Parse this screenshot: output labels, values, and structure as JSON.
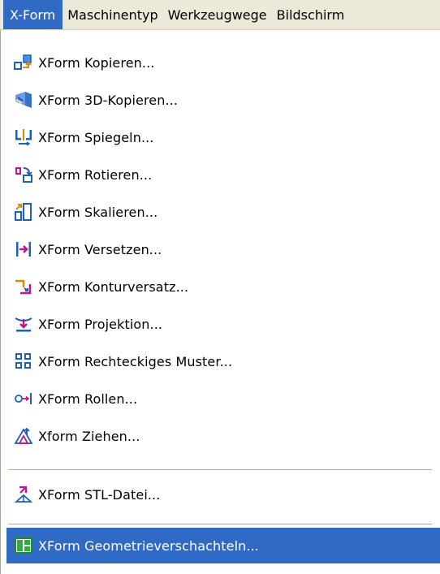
{
  "menubar": {
    "items": [
      "X-Form",
      "Maschinentyp",
      "Werkzeugwege",
      "Bildschirm"
    ],
    "active_index": 0
  },
  "menu": {
    "items": [
      {
        "label": "XForm Kopieren...",
        "icon": "copy-icon"
      },
      {
        "label": "XForm 3D-Kopieren...",
        "icon": "3d-copy-icon"
      },
      {
        "label": "XForm Spiegeln...",
        "icon": "mirror-icon"
      },
      {
        "label": "XForm Rotieren...",
        "icon": "rotate-icon"
      },
      {
        "label": "XForm Skalieren...",
        "icon": "scale-icon"
      },
      {
        "label": "XForm Versetzen...",
        "icon": "translate-icon"
      },
      {
        "label": "XForm Konturversatz...",
        "icon": "contour-offset-icon"
      },
      {
        "label": "XForm Projektion...",
        "icon": "projection-icon"
      },
      {
        "label": "XForm Rechteckiges Muster...",
        "icon": "rectangular-pattern-icon"
      },
      {
        "label": "XForm Rollen...",
        "icon": "roll-icon"
      },
      {
        "label": "Xform Ziehen...",
        "icon": "drag-icon"
      },
      {
        "label": "XForm STL-Datei...",
        "icon": "stl-file-icon"
      },
      {
        "label": "XForm Geometrieverschachteln...",
        "icon": "nesting-icon",
        "highlighted": true
      }
    ]
  },
  "colors": {
    "highlight": "#316ac5",
    "menubar_bg": "#ece9d8",
    "separator": "#aca899"
  }
}
